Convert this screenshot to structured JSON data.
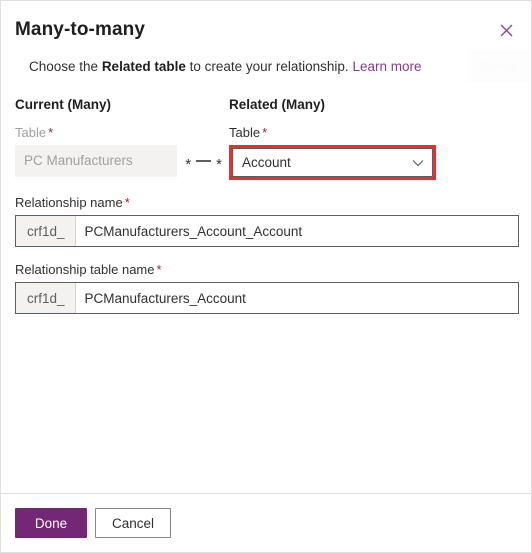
{
  "dialog": {
    "title": "Many-to-many",
    "close_icon": "close-icon",
    "ghost_cancel_label": "Cancel"
  },
  "subtitle": {
    "lead": "Choose the ",
    "emphasis": "Related table",
    "trail": " to create your relationship. ",
    "link_label": "Learn more"
  },
  "current": {
    "heading": "Current (Many)",
    "table_label": "Table",
    "required_mark": "*",
    "table_value": "PC Manufacturers"
  },
  "cardinality": {
    "left": "*",
    "right": "*"
  },
  "related": {
    "heading": "Related (Many)",
    "table_label": "Table",
    "required_mark": "*",
    "selected_value": "Account",
    "chevron_icon": "chevron-down-icon",
    "highlight_color": "#ef2b2b"
  },
  "relationship_name": {
    "label": "Relationship name",
    "required_mark": "*",
    "prefix": "crf1d_",
    "value": "PCManufacturers_Account_Account"
  },
  "relationship_table_name": {
    "label": "Relationship table name",
    "required_mark": "*",
    "prefix": "crf1d_",
    "value": "PCManufacturers_Account"
  },
  "footer": {
    "done_label": "Done",
    "cancel_label": "Cancel"
  },
  "colors": {
    "primary": "#742774",
    "link": "#8a3a8a",
    "required": "#a4262c",
    "highlight": "#ef2b2b",
    "disabled_bg": "#f3f2f1",
    "disabled_text": "#a19f9d"
  }
}
